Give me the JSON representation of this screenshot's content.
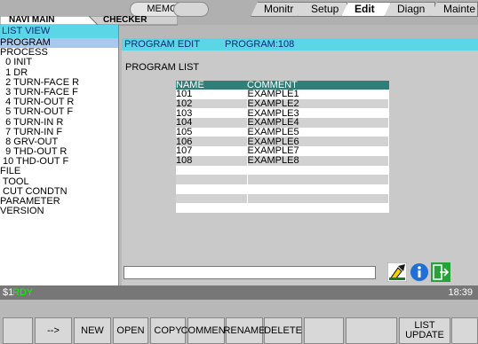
{
  "header": {
    "mode": "MEMORY",
    "tabs": [
      {
        "label": "Monitr",
        "active": false
      },
      {
        "label": "Setup",
        "active": false
      },
      {
        "label": "Edit",
        "active": true
      },
      {
        "label": "Diagn",
        "active": false
      },
      {
        "label": "Mainte",
        "active": false
      }
    ],
    "subtabs": [
      "NAVI MAIN",
      "CHECKER"
    ]
  },
  "left": {
    "title": "LIST VIEW",
    "items": [
      {
        "label": "PROGRAM",
        "selected": true
      },
      {
        "label": "PROCESS"
      },
      {
        "label": "  0 INIT"
      },
      {
        "label": "  1 DR"
      },
      {
        "label": "  2 TURN-FACE R"
      },
      {
        "label": "  3 TURN-FACE F"
      },
      {
        "label": "  4 TURN-OUT R"
      },
      {
        "label": "  5 TURN-OUT F"
      },
      {
        "label": "  6 TURN-IN R"
      },
      {
        "label": "  7 TURN-IN F"
      },
      {
        "label": "  8 GRV-OUT"
      },
      {
        "label": "  9 THD-OUT R"
      },
      {
        "label": " 10 THD-OUT F"
      },
      {
        "label": "FILE"
      },
      {
        "label": " TOOL"
      },
      {
        "label": " CUT CONDTN"
      },
      {
        "label": "PARAMETER"
      },
      {
        "label": "VERSION"
      }
    ]
  },
  "main": {
    "header_left": "PROGRAM EDIT",
    "header_right": "PROGRAM:108",
    "list_title": "PROGRAM LIST",
    "columns": [
      "NAME",
      "COMMENT"
    ],
    "rows": [
      [
        "101",
        "EXAMPLE1"
      ],
      [
        "102",
        "EXAMPLE2"
      ],
      [
        "103",
        "EXAMPLE3"
      ],
      [
        "104",
        "EXAMPLE4"
      ],
      [
        "105",
        "EXAMPLE5"
      ],
      [
        "106",
        "EXAMPLE6"
      ],
      [
        "107",
        "EXAMPLE7"
      ],
      [
        "108",
        "EXAMPLE8"
      ],
      [
        "",
        ""
      ],
      [
        "",
        ""
      ],
      [
        "",
        ""
      ],
      [
        "",
        ""
      ],
      [
        "",
        ""
      ]
    ]
  },
  "status": {
    "prefix": "$1",
    "state": "RDY",
    "time": "18:39"
  },
  "softkeys": [
    "-->",
    "NEW",
    "OPEN",
    "COPY",
    "COMMENT",
    "RENAME",
    "DELETE",
    "",
    "",
    "LIST\nUPDATE",
    ""
  ],
  "icons": [
    "machine-icon",
    "info-icon",
    "exit-icon"
  ]
}
